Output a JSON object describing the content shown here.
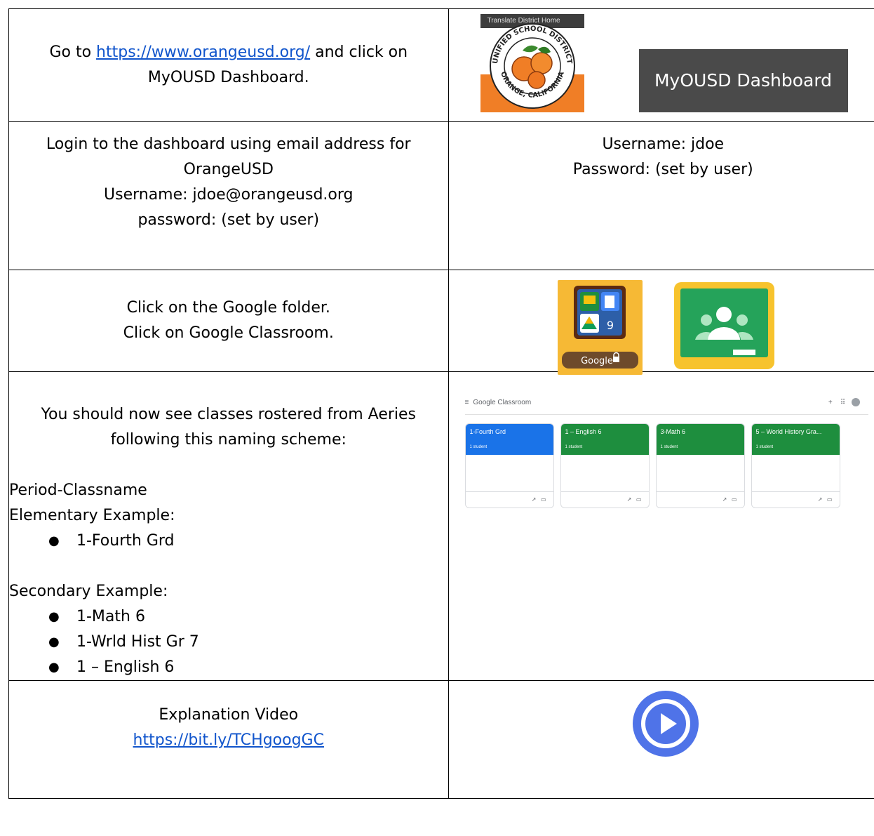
{
  "rows": [
    {
      "instr_prefix": "Go to ",
      "instr_link": "https://www.orangeusd.org/",
      "instr_suffix": " and click on",
      "instr_line2": "MyOUSD Dashboard.",
      "logo_bar_text": "Translate  District Home",
      "logo_ring_top": "UNIFIED SCHOOL DISTRICT",
      "logo_ring_left": "ORANGE",
      "logo_ring_bottom": "ORANGE, CALIFORNIA",
      "dashboard_button": "MyOUSD Dashboard"
    },
    {
      "lines": [
        "Login to the dashboard using email address for",
        "OrangeUSD",
        "Username: jdoe@orangeusd.org",
        "password:  (set by user)"
      ],
      "right_lines": [
        "Username: jdoe",
        "Password: (set by user)"
      ]
    },
    {
      "lines": [
        "Click on the Google folder.",
        "Click on Google Classroom."
      ],
      "folder_badge": "9",
      "folder_label": "Google"
    },
    {
      "lines": [
        "You should now see classes rostered from Aeries",
        "following this naming scheme:"
      ],
      "scheme_title": "Period-Classname",
      "elem_title": "Elementary Example:",
      "elem_items": [
        "1-Fourth Grd"
      ],
      "sec_title": "Secondary Example:",
      "sec_items": [
        "1-Math 6",
        "1-Wrld Hist Gr 7",
        "1 – English 6"
      ],
      "gc_app_title": "Google Classroom",
      "gc_cards": [
        {
          "name": "1-Fourth Grd",
          "sub": "1 student",
          "color": "#1a73e8"
        },
        {
          "name": "1 – English 6",
          "sub": "1 student",
          "color": "#1e8e3e"
        },
        {
          "name": "3-Math 6",
          "sub": "1 student",
          "color": "#1e8e3e"
        },
        {
          "name": "5 – World History Gra...",
          "sub": "1 student",
          "color": "#1e8e3e"
        }
      ]
    },
    {
      "title": "Explanation Video",
      "link": "https://bit.ly/TCHgoogGC"
    }
  ],
  "colors": {
    "link": "#1155cc",
    "play": "#4f73e8",
    "orange": "#f07e26"
  }
}
